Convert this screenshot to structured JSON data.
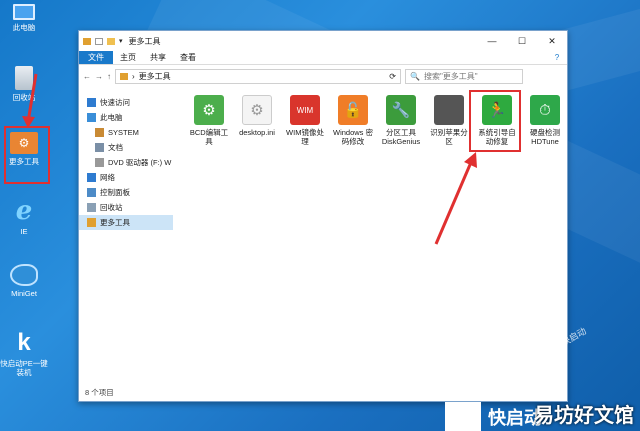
{
  "desktop": {
    "icons": [
      {
        "label": "此电脑",
        "icon": "pc-icon"
      },
      {
        "label": "回收站",
        "icon": "recycle-bin-icon"
      },
      {
        "label": "更多工具",
        "icon": "tools-folder-icon"
      },
      {
        "label": "IE",
        "icon": "ie-icon"
      },
      {
        "label": "MiniGet",
        "icon": "fish-icon"
      },
      {
        "label": "快启动PE一键装机",
        "icon": "k-logo-icon"
      }
    ],
    "side_text": "快启动",
    "corner_text": "快启动",
    "watermark": "易坊好文馆"
  },
  "window": {
    "title": "更多工具",
    "controls": {
      "minimize": "—",
      "maximize": "☐",
      "close": "✕"
    },
    "ribbon": {
      "file": "文件",
      "tabs": [
        "主页",
        "共享",
        "查看"
      ]
    },
    "address": {
      "path": "更多工具",
      "placeholder": "搜索\"更多工具\""
    },
    "nav": [
      {
        "label": "快速访问",
        "level": 1,
        "icon": "star-icon",
        "color": "#2e7bd0"
      },
      {
        "label": "此电脑",
        "level": 1,
        "icon": "pc-icon",
        "color": "#3a8ed8"
      },
      {
        "label": "SYSTEM",
        "level": 2,
        "icon": "user-icon",
        "color": "#c98a34"
      },
      {
        "label": "文档",
        "level": 2,
        "icon": "document-icon",
        "color": "#7a8fa6"
      },
      {
        "label": "DVD 驱动器 (F:) W",
        "level": 2,
        "icon": "disc-icon",
        "color": "#999999"
      },
      {
        "label": "网络",
        "level": 1,
        "icon": "network-icon",
        "color": "#2e7bd0"
      },
      {
        "label": "控制面板",
        "level": 1,
        "icon": "control-panel-icon",
        "color": "#4d8bc7"
      },
      {
        "label": "回收站",
        "level": 1,
        "icon": "recycle-bin-icon",
        "color": "#8aa0b5"
      },
      {
        "label": "更多工具",
        "level": 1,
        "icon": "folder-icon",
        "color": "#e0a030",
        "selected": true
      }
    ],
    "files": [
      {
        "label": "BCD编辑工具",
        "icon": "gear-icon",
        "color": "#4cae4c",
        "glyph": "⚙"
      },
      {
        "label": "desktop.ini",
        "icon": "ini-file-icon",
        "color": "#f4f4f4",
        "glyph": "⚙"
      },
      {
        "label": "WIM镜像处理",
        "icon": "wim-icon",
        "color": "#d9352c",
        "glyph": "WIM"
      },
      {
        "label": "Windows 密码修改",
        "icon": "lock-icon",
        "color": "#f07d28",
        "glyph": "🔓"
      },
      {
        "label": "分区工具 DiskGenius",
        "icon": "wrench-icon",
        "color": "#3c9c3c",
        "glyph": "🔧"
      },
      {
        "label": "识别苹果分区",
        "icon": "apple-icon",
        "color": "#555555",
        "glyph": ""
      },
      {
        "label": "系统引导自动修复",
        "icon": "exit-run-icon",
        "color": "#2eaa3f",
        "glyph": "🏃"
      },
      {
        "label": "硬盘检测 HDTune",
        "icon": "clock-check-icon",
        "color": "#2ea84a",
        "glyph": "⏱"
      }
    ],
    "status": "8 个项目"
  },
  "colors": {
    "accent": "#1979ca",
    "highlight": "#e03030",
    "desktop": "#1f84d4"
  }
}
